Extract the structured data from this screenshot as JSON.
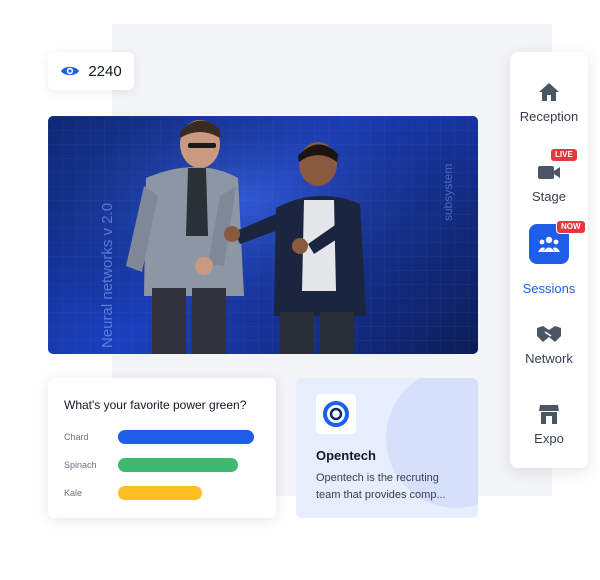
{
  "views": {
    "count": "2240",
    "icon": "eye-icon"
  },
  "sidebar": {
    "items": [
      {
        "label": "Reception",
        "icon": "home-icon"
      },
      {
        "label": "Stage",
        "icon": "video-camera-icon",
        "badge": "LIVE"
      },
      {
        "label": "Sessions",
        "icon": "group-icon",
        "badge": "NOW",
        "active": true
      },
      {
        "label": "Network",
        "icon": "handshake-icon"
      },
      {
        "label": "Expo",
        "icon": "booth-icon"
      }
    ]
  },
  "video": {
    "screen_text_1": "Neural networks v 2.0",
    "screen_text_2": "subsystem"
  },
  "poll": {
    "question": "What's your favorite power green?",
    "options": [
      {
        "label": "Chard",
        "value": 1.0,
        "color": "#1d5fe8"
      },
      {
        "label": "Spinach",
        "value": 0.88,
        "color": "#3dba6e"
      },
      {
        "label": "Kale",
        "value": 0.62,
        "color": "#fbbf24"
      }
    ]
  },
  "org": {
    "name": "Opentech",
    "description": "Opentech is the recruting team that provides comp..."
  },
  "colors": {
    "accent": "#1d5fe8",
    "live": "#e0393e"
  }
}
